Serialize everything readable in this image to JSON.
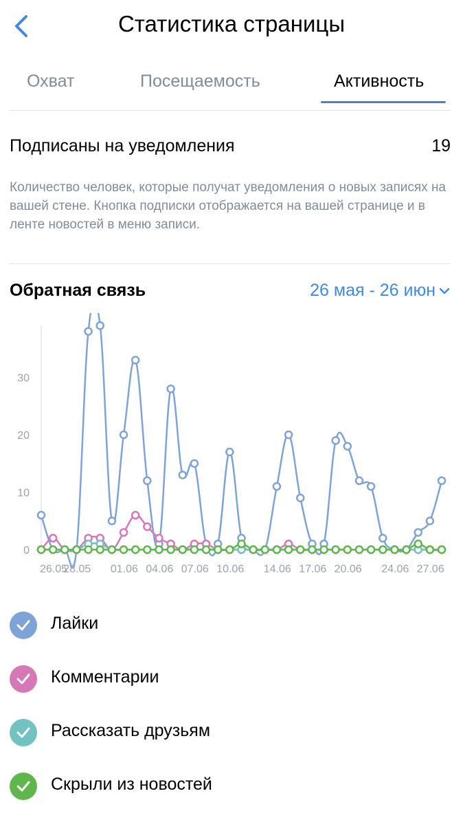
{
  "header": {
    "title": "Статистика страницы"
  },
  "tabs": [
    {
      "label": "Охват"
    },
    {
      "label": "Посещаемость"
    },
    {
      "label": "Активность"
    }
  ],
  "subscriptions": {
    "label": "Подписаны на уведомления",
    "count": "19"
  },
  "description": "Количество человек, которые получат уведомления о новых записях на вашей стене. Кнопка подписки отображается на вашей странице и в ленте новостей в меню записи.",
  "feedback": {
    "title": "Обратная связь",
    "date_range": "26 мая - 26 июн"
  },
  "legend": [
    {
      "label": "Лайки",
      "color": "#7ea3d6"
    },
    {
      "label": "Комментарии",
      "color": "#d677b6"
    },
    {
      "label": "Рассказать друзьям",
      "color": "#72c1c3"
    },
    {
      "label": "Скрыли из новостей",
      "color": "#5fb64b"
    }
  ],
  "chart_data": {
    "type": "line",
    "x": [
      "26.05",
      "27.05",
      "28.05",
      "29.05",
      "30.05",
      "31.05",
      "01.06",
      "02.06",
      "03.06",
      "04.06",
      "05.06",
      "06.06",
      "07.06",
      "08.06",
      "09.06",
      "10.06",
      "11.06",
      "12.06",
      "13.06",
      "14.06",
      "15.06",
      "16.06",
      "17.06",
      "18.06",
      "19.06",
      "20.06",
      "21.06",
      "22.06",
      "23.06",
      "24.06",
      "25.06",
      "26.06",
      "27.06",
      "28.06",
      "29.06"
    ],
    "x_tick_labels": [
      "26.05",
      "28.05",
      "01.06",
      "04.06",
      "07.06",
      "10.06",
      "14.06",
      "17.06",
      "20.06",
      "24.06",
      "27.06"
    ],
    "ylim": [
      0,
      39
    ],
    "y_ticks": [
      0,
      10,
      20,
      30
    ],
    "series": [
      {
        "name": "Лайки",
        "color": "#7ea3d6",
        "values": [
          6,
          0,
          0,
          0,
          38,
          39,
          5,
          20,
          33,
          12,
          1,
          28,
          13,
          15,
          1,
          1,
          17,
          2,
          0,
          0,
          11,
          20,
          9,
          1,
          1,
          19,
          18,
          12,
          11,
          2,
          0,
          0,
          3,
          5,
          12
        ]
      },
      {
        "name": "Комментарии",
        "color": "#d677b6",
        "values": [
          0,
          2,
          0,
          0,
          2,
          2,
          0,
          3,
          6,
          4,
          2,
          1,
          0,
          1,
          1,
          0,
          0,
          0,
          0,
          0,
          0,
          1,
          0,
          0,
          0,
          0,
          0,
          0,
          0,
          0,
          0,
          0,
          0,
          0,
          0
        ]
      },
      {
        "name": "Рассказать друзьям",
        "color": "#72c1c3",
        "values": [
          0,
          0,
          0,
          0,
          1,
          1,
          0,
          0,
          0,
          0,
          0,
          0,
          0,
          0,
          0,
          0,
          0,
          0,
          0,
          0,
          0,
          0,
          0,
          0,
          0,
          0,
          0,
          0,
          0,
          0,
          0,
          0,
          0,
          0,
          0
        ]
      },
      {
        "name": "Скрыли из новостей",
        "color": "#5fb64b",
        "values": [
          0,
          0,
          0,
          0,
          0,
          0,
          0,
          0,
          0,
          0,
          0,
          0,
          0,
          0,
          0,
          0,
          0,
          1,
          0,
          0,
          0,
          0,
          0,
          0,
          0,
          0,
          0,
          0,
          0,
          0,
          0,
          0,
          1,
          0,
          0
        ]
      }
    ],
    "grid": false
  }
}
